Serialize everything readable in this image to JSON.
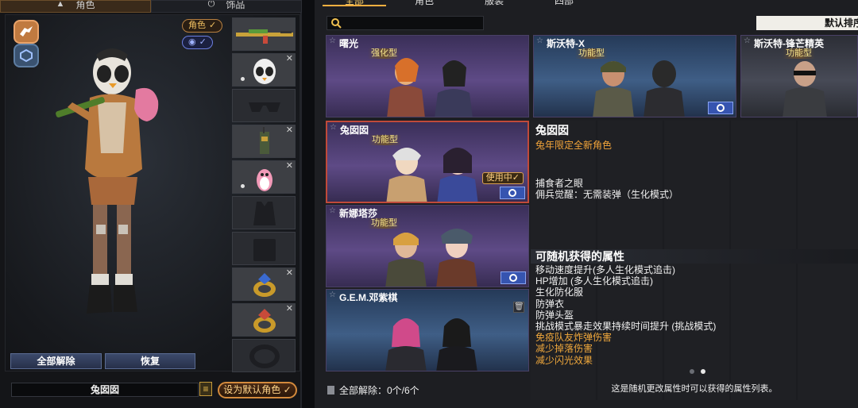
{
  "left": {
    "tabs": [
      {
        "label": "角色",
        "icon": "person-icon",
        "active": true
      },
      {
        "label": "饰品",
        "icon": "power-icon",
        "active": false
      }
    ],
    "mode_buttons": [
      {
        "icon": "zombie-mode-icon",
        "color": "#c07a40"
      },
      {
        "icon": "view-mode-icon",
        "color": "#3a5270"
      }
    ],
    "toggles": {
      "role_label": "角色",
      "role_check": "✓",
      "eye_check": "✓"
    },
    "slots": [
      {
        "item": "rifle",
        "has_close": false,
        "has_dot": false
      },
      {
        "item": "penguin-mask",
        "has_close": true,
        "has_dot": true
      },
      {
        "item": "sunglasses-empty",
        "has_close": false,
        "has_dot": false
      },
      {
        "item": "walkie-talkie",
        "has_close": true,
        "has_dot": false
      },
      {
        "item": "pink-penguin-pet",
        "has_close": true,
        "has_dot": true
      },
      {
        "item": "vest-empty",
        "has_close": false,
        "has_dot": false
      },
      {
        "item": "backpack-empty",
        "has_close": false,
        "has_dot": false
      },
      {
        "item": "ring-gold",
        "has_close": true,
        "has_dot": false
      },
      {
        "item": "ring-gold-2",
        "has_close": true,
        "has_dot": false
      },
      {
        "item": "bracelet-empty",
        "has_close": false,
        "has_dot": false
      }
    ],
    "buttons": {
      "unequip_all": "全部解除",
      "restore": "恢复",
      "set_default": "设为默认角色",
      "set_default_check": "✓"
    },
    "selected_name": "兔囡囡",
    "list_icon": "≡"
  },
  "main": {
    "tabs": [
      {
        "label": "全部",
        "active": true
      },
      {
        "label": "角色",
        "active": false
      },
      {
        "label": "服装",
        "active": false
      },
      {
        "label": "四部",
        "active": false
      }
    ],
    "search": {
      "placeholder": ""
    },
    "sort_label": "默认排序",
    "cards": [
      {
        "title": "曙光",
        "type": "强化型",
        "theme": "purple",
        "selected": false,
        "gear": false,
        "using": false,
        "trash": false
      },
      {
        "title": "斯沃特-X",
        "type": "功能型",
        "theme": "blue",
        "selected": false,
        "gear": true,
        "using": false,
        "trash": false
      },
      {
        "title": "斯沃特-锋芒精英",
        "type": "功能型",
        "theme": "gray",
        "selected": false,
        "gear": false,
        "using": false,
        "trash": false
      },
      {
        "title": "兔囡囡",
        "type": "功能型",
        "theme": "purple",
        "selected": true,
        "gear": true,
        "using": true,
        "trash": false
      },
      {
        "title": "新娜塔莎",
        "type": "功能型",
        "theme": "purple",
        "selected": false,
        "gear": true,
        "using": false,
        "trash": false
      },
      {
        "title": "G.E.M.邓紫棋",
        "type": "",
        "theme": "blue",
        "selected": false,
        "gear": false,
        "using": false,
        "trash": true
      }
    ],
    "using_label": "使用中✓",
    "detail": {
      "name": "兔囡囡",
      "subtitle": "兔年限定全新角色",
      "skills": [
        "捕食者之眼",
        "佣兵觉醒：无需装弹（生化模式）"
      ],
      "attr_header": "可随机获得的属性",
      "attributes": [
        {
          "text": "移动速度提升(多人生化模式追击)",
          "highlight": false
        },
        {
          "text": "HP增加 (多人生化模式追击)",
          "highlight": false
        },
        {
          "text": "生化防化服",
          "highlight": false
        },
        {
          "text": "防弹衣",
          "highlight": false
        },
        {
          "text": "防弹头盔",
          "highlight": false
        },
        {
          "text": "挑战模式暴走效果持续时间提升 (挑战模式)",
          "highlight": false
        },
        {
          "text": "免疫队友炸弹伤害",
          "highlight": true
        },
        {
          "text": "减少掉落伤害",
          "highlight": true
        },
        {
          "text": "减少闪光效果",
          "highlight": true
        }
      ],
      "pager": {
        "pages": 2,
        "current": 2
      },
      "footnote": "这是随机更改属性时可以获得的属性列表。"
    },
    "remove_all": "全部解除：0个/6个"
  },
  "colors": {
    "accent": "#f0a83c",
    "selected_border": "#c04a3a",
    "gear_button": "#3654b0"
  }
}
